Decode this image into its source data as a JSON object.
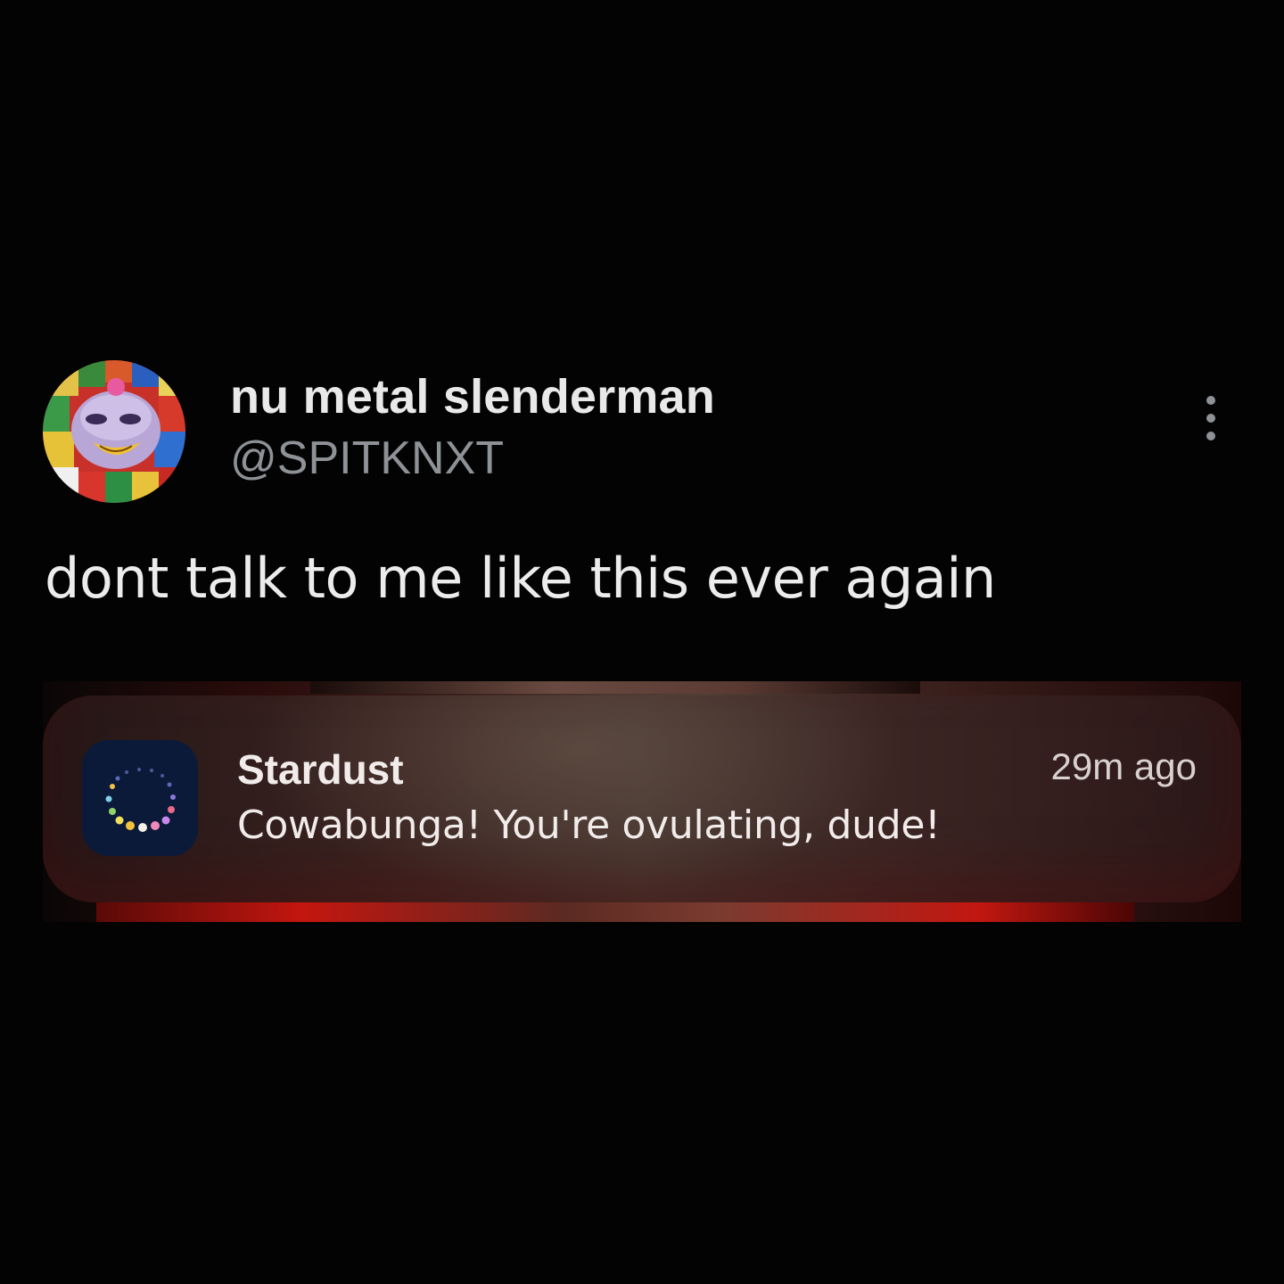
{
  "tweet": {
    "display_name": "nu metal slenderman",
    "handle": "@SPITKNXT",
    "text": "dont talk to me like this ever again",
    "avatar_icon": "jester-character-avatar",
    "more_icon": "more-options-icon"
  },
  "notification": {
    "app_name": "Stardust",
    "time": "29m ago",
    "body": "Cowabunga! You're ovulating, dude!",
    "app_icon": "stardust-app-icon"
  },
  "colors": {
    "background": "#000000",
    "primary_text": "#e9e9e9",
    "secondary_text": "#8e9296",
    "notification_bg": "#3a2421",
    "app_icon_bg": "#0c1a3a"
  }
}
